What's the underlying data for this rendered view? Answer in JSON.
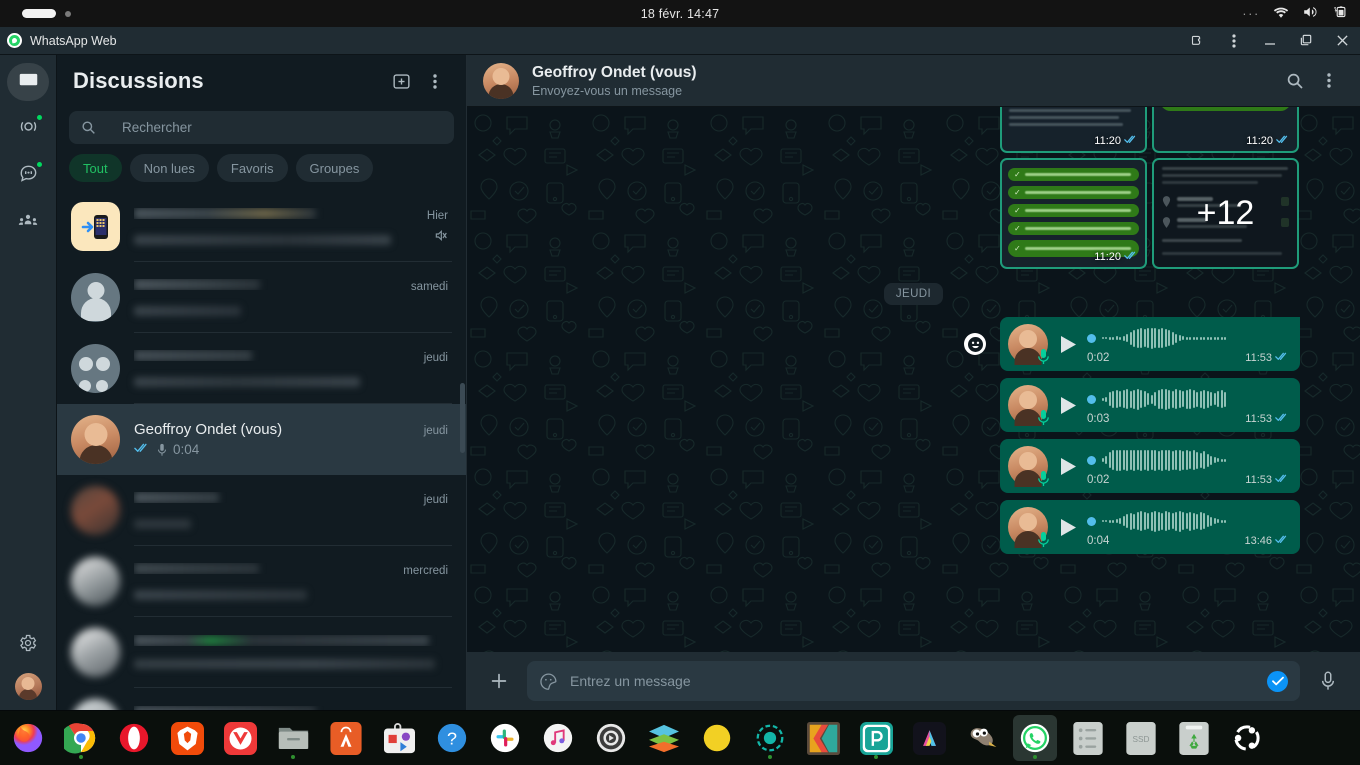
{
  "system_bar": {
    "datetime": "18 févr.  14:47",
    "overflow": "···",
    "icons": [
      "wifi-icon",
      "volume-icon",
      "battery-charging-icon"
    ]
  },
  "title_bar": {
    "app_title": "WhatsApp Web",
    "logo": "whatsapp-logo-icon",
    "buttons": [
      {
        "name": "extensions-icon",
        "glyph": "⬡"
      },
      {
        "name": "menu-kebab-icon",
        "glyph": "⋮"
      },
      {
        "name": "minimize-icon",
        "glyph": "—"
      },
      {
        "name": "maximize-icon",
        "glyph": "❐"
      },
      {
        "name": "close-icon",
        "glyph": "✕"
      }
    ]
  },
  "rail": {
    "items": [
      {
        "name": "chats-icon",
        "active": true,
        "badge": false
      },
      {
        "name": "status-icon",
        "active": false,
        "badge": true
      },
      {
        "name": "channels-icon",
        "active": false,
        "badge": true
      },
      {
        "name": "communities-icon",
        "active": false,
        "badge": false
      }
    ],
    "settings": {
      "name": "settings-gear-icon"
    },
    "profile": {
      "name": "profile-avatar"
    }
  },
  "chat_list": {
    "title": "Discussions",
    "new_chat_icon": "new-chat-icon",
    "menu_icon": "kebab-menu-icon",
    "search": {
      "placeholder": "Rechercher",
      "value": "",
      "icon": "search-icon"
    },
    "filters": [
      {
        "label": "Tout",
        "active": true
      },
      {
        "label": "Non lues",
        "active": false
      },
      {
        "label": "Favoris",
        "active": false
      },
      {
        "label": "Groupes",
        "active": false
      }
    ],
    "rows": [
      {
        "avatar": "phone-app-icon",
        "name": "",
        "preview": "",
        "time": "Hier",
        "redacted": true,
        "muted": true,
        "selected": false
      },
      {
        "avatar": "person-placeholder",
        "name": "",
        "preview": "",
        "time": "samedi",
        "redacted": true,
        "muted": false,
        "selected": false
      },
      {
        "avatar": "group-placeholder",
        "name": "",
        "preview": "",
        "time": "jeudi",
        "redacted": true,
        "muted": false,
        "selected": false
      },
      {
        "avatar": "user-photo",
        "name": "Geoffroy Ondet (vous)",
        "preview": "0:04",
        "time": "jeudi",
        "redacted": false,
        "muted": false,
        "selected": true,
        "status": "read-double-check",
        "preview_icon": "microphone-icon"
      },
      {
        "avatar": "redacted-photo",
        "name": "",
        "preview": "",
        "time": "jeudi",
        "redacted": true,
        "muted": false,
        "selected": false
      },
      {
        "avatar": "redacted-photo",
        "name": "",
        "preview": "",
        "time": "mercredi",
        "redacted": true,
        "muted": false,
        "selected": false
      },
      {
        "avatar": "redacted-photo",
        "name": "",
        "preview": "",
        "time": "",
        "redacted": true,
        "muted": false,
        "selected": false
      },
      {
        "avatar": "redacted-photo",
        "name": "",
        "preview": "",
        "time": "",
        "redacted": true,
        "muted": false,
        "selected": false
      }
    ]
  },
  "conversation": {
    "title": "Geoffroy Ondet (vous)",
    "subtitle": "Envoyez-vous un message",
    "search_icon": "search-icon",
    "menu_icon": "kebab-menu-icon",
    "date_divider": "JEUDI",
    "album": {
      "more_count": "+12",
      "cells": [
        {
          "timestamp": "11:20",
          "status": "read-double-check",
          "kind": "screenshot-verified-places"
        },
        {
          "timestamp": "11:20",
          "status": "read-double-check",
          "kind": "screenshot-toasts"
        },
        {
          "timestamp": "11:20",
          "status": "read-double-check",
          "kind": "screenshot-settings-list"
        },
        {
          "timestamp": "",
          "status": "",
          "kind": "screenshot-addresses",
          "overlay": "+12"
        }
      ]
    },
    "voice_messages": [
      {
        "duration": "0:02",
        "time": "11:53",
        "status": "read-double-check",
        "play_icon": "play-icon",
        "mic_icon": "microphone-icon"
      },
      {
        "duration": "0:03",
        "time": "11:53",
        "status": "read-double-check",
        "play_icon": "play-icon",
        "mic_icon": "microphone-icon"
      },
      {
        "duration": "0:02",
        "time": "11:53",
        "status": "read-double-check",
        "play_icon": "play-icon",
        "mic_icon": "microphone-icon"
      },
      {
        "duration": "0:04",
        "time": "13:46",
        "status": "read-double-check",
        "play_icon": "play-icon",
        "mic_icon": "microphone-icon"
      }
    ],
    "reaction_button": "emoji-reaction-icon"
  },
  "composer": {
    "attach_icon": "plus-attach-icon",
    "sticker_icon": "sticker-icon",
    "placeholder": "Entrez un message",
    "value": "",
    "send_icon": "send-check-icon",
    "mic_icon": "microphone-icon"
  },
  "dock": {
    "items": [
      {
        "name": "firefox-icon",
        "running": false
      },
      {
        "name": "google-chrome-icon",
        "running": true
      },
      {
        "name": "opera-icon",
        "running": false
      },
      {
        "name": "brave-icon",
        "running": false
      },
      {
        "name": "vivaldi-icon",
        "running": false
      },
      {
        "name": "files-icon",
        "running": true
      },
      {
        "name": "app-store-icon",
        "running": false
      },
      {
        "name": "media-toolbox-icon",
        "running": false
      },
      {
        "name": "help-icon",
        "running": false
      },
      {
        "name": "slack-icon",
        "running": false
      },
      {
        "name": "music-icon",
        "running": false
      },
      {
        "name": "settings-icon",
        "running": false
      },
      {
        "name": "layers-icon",
        "running": false
      },
      {
        "name": "yellow-circle-icon",
        "running": false
      },
      {
        "name": "teal-ring-icon",
        "running": true
      },
      {
        "name": "kdenlive-icon",
        "running": false
      },
      {
        "name": "photopea-icon",
        "running": true
      },
      {
        "name": "affinity-icon",
        "running": false
      },
      {
        "name": "gimp-icon",
        "running": false
      },
      {
        "name": "whatsapp-icon",
        "running": true,
        "active": true
      },
      {
        "name": "file-list-icon",
        "running": false
      },
      {
        "name": "ssd-drive-icon",
        "label": "SSD",
        "running": false
      },
      {
        "name": "trash-icon",
        "running": false
      },
      {
        "name": "ubuntu-icon",
        "running": false
      }
    ]
  },
  "colors": {
    "brand_green": "#25d366",
    "bubble_out": "#005c4b",
    "accent_blue": "#53bdeb",
    "panel": "#111b21",
    "header": "#202c33"
  }
}
